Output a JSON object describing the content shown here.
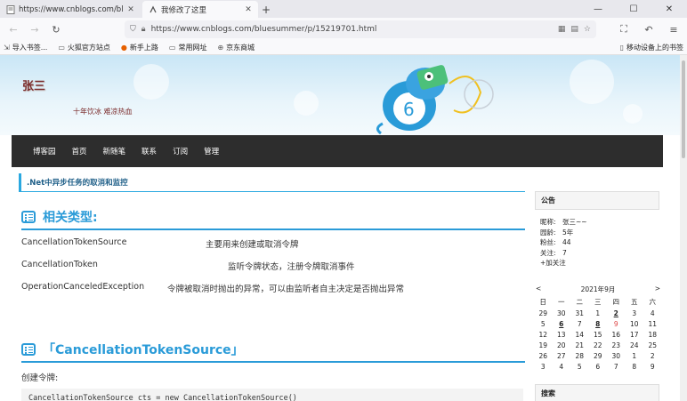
{
  "browser": {
    "tabs": [
      {
        "title": "https://www.cnblogs.com/bl",
        "active": false
      },
      {
        "title": "我修改了这里",
        "active": true
      }
    ],
    "url": "https://www.cnblogs.com/bluesummer/p/15219701.html",
    "bookmarks": [
      "导入书签...",
      "火狐官方站点",
      "新手上路",
      "常用网址",
      "京东商城"
    ],
    "mobile_bookmarks": "移动设备上的书签"
  },
  "blog": {
    "title": "张三",
    "subtitle": "十年饮冰 难凉热血",
    "menu": [
      "博客园",
      "首页",
      "新随笔",
      "联系",
      "订阅",
      "管理"
    ]
  },
  "post": {
    "title": ".Net中异步任务的取消和监控",
    "section1": "相关类型:",
    "types": [
      {
        "name": "CancellationTokenSource",
        "desc": "主要用来创建或取消令牌"
      },
      {
        "name": "CancellationToken",
        "desc": "监听令牌状态，注册令牌取消事件"
      },
      {
        "name": "OperationCanceledException",
        "desc": "令牌被取消时抛出的异常，可以由监听者自主决定是否抛出异常"
      }
    ],
    "section2": "「CancellationTokenSource」",
    "create_label": "创建令牌:",
    "code_line": "CancellationTokenSource cts = new CancellationTokenSource()"
  },
  "sidebar": {
    "notice_title": "公告",
    "profile": [
      {
        "k": "昵称:",
        "v": "张三~~"
      },
      {
        "k": "园龄:",
        "v": "5年"
      },
      {
        "k": "粉丝:",
        "v": "44"
      },
      {
        "k": "关注:",
        "v": "7"
      }
    ],
    "follow": "+加关注",
    "calendar": {
      "prev": "<",
      "month": "2021年9月",
      "next": ">",
      "weekdays": [
        "日",
        "一",
        "二",
        "三",
        "四",
        "五",
        "六"
      ],
      "days": [
        "29",
        "30",
        "31",
        "1",
        "2",
        "3",
        "4",
        "5",
        "6",
        "7",
        "8",
        "9",
        "10",
        "11",
        "12",
        "13",
        "14",
        "15",
        "16",
        "17",
        "18",
        "19",
        "20",
        "21",
        "22",
        "23",
        "24",
        "25",
        "26",
        "27",
        "28",
        "29",
        "30",
        "1",
        "2",
        "3",
        "4",
        "5",
        "6",
        "7",
        "8",
        "9"
      ],
      "linked": [
        "2",
        "6",
        "8"
      ],
      "today": "9"
    },
    "search_title": "搜索"
  }
}
